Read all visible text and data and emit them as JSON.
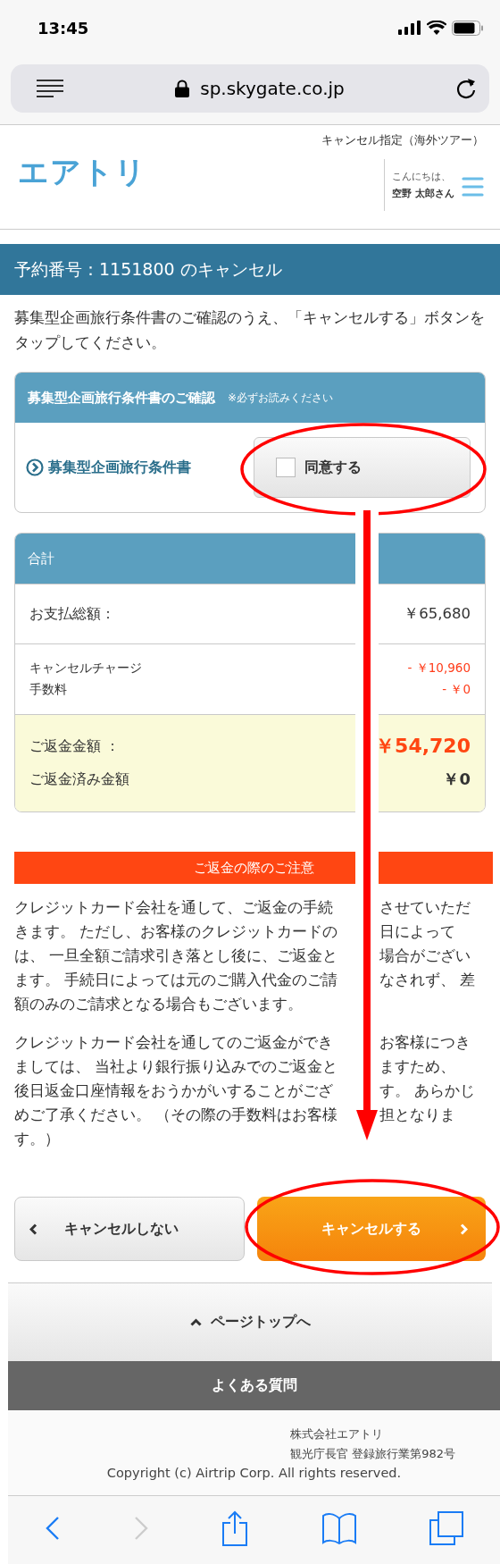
{
  "status_bar": {
    "time": "13:45"
  },
  "browser": {
    "url": "sp.skygate.co.jp"
  },
  "header": {
    "page_label": "キャンセル指定（海外ツアー）",
    "logo": "エアトリ",
    "greeting": "こんにちは、",
    "user_name": "空野 太郎さん"
  },
  "title": "予約番号：1151800 のキャンセル",
  "intro": "募集型企画旅行条件書のご確認のうえ、「キャンセルする」ボタンをタップしてください。",
  "terms": {
    "heading": "募集型企画旅行条件書のご確認",
    "note": "※必ずお読みください",
    "link": "募集型企画旅行条件書",
    "agree": {
      "label": "同意する",
      "checked": false
    }
  },
  "totals": {
    "heading": "合計",
    "sections": [
      {
        "highlighted": false,
        "items": [
          {
            "label": "お支払総額：",
            "value": "￥65,680",
            "kind": "amount"
          }
        ]
      },
      {
        "highlighted": false,
        "items": [
          {
            "label": "キャンセルチャージ",
            "value": "- ￥10,960",
            "kind": "charge"
          },
          {
            "label": "手数料",
            "value": "- ￥0",
            "kind": "charge"
          }
        ]
      },
      {
        "highlighted": true,
        "items": [
          {
            "label": "ご返金金額 ：",
            "value": "￥54,720",
            "kind": "refund"
          },
          {
            "label": "ご返金済み金額",
            "value": "￥0",
            "kind": "refunded"
          }
        ]
      }
    ]
  },
  "notice": {
    "heading": "ご返金の際のご注意",
    "paragraphs": [
      {
        "lines": [
          {
            "left": "クレジットカード会社を通して、ご返金の手続",
            "right": "させていただ"
          },
          {
            "left": "きます。 ただし、お客様のクレジットカードの",
            "right": "日によって"
          },
          {
            "left": "は、 一旦全額ご請求引き落とし後に、ご返金と",
            "right": "場合がござい"
          },
          {
            "left": "ます。 手続日によっては元のご購入代金のご請",
            "right": "なされず、 差"
          },
          {
            "left": "額のみのご請求となる場合もございます。"
          }
        ]
      },
      {
        "lines": [
          {
            "left": "クレジットカード会社を通してのご返金ができ",
            "right": "お客様につき"
          },
          {
            "left": "ましては、 当社より銀行振り込みでのご返金と",
            "right": "ますため、"
          },
          {
            "left": "後日返金口座情報をおうかがいすることがござ",
            "right": "す。 あらかじ"
          },
          {
            "left": "めご了承ください。 （その際の手数料はお客様",
            "right": "担となりま"
          },
          {
            "left": "す。）"
          }
        ]
      }
    ]
  },
  "buttons": [
    {
      "label": "キャンセルしない",
      "kind": "back"
    },
    {
      "label": "キャンセルする",
      "kind": "primary"
    }
  ],
  "page_top": "ページトップへ",
  "faq": "よくある質問",
  "footer": {
    "company": "株式会社エアトリ",
    "registration": "観光庁長官 登録旅行業第982号",
    "copyright": "Copyright (c) Airtrip Corp. All rights reserved."
  },
  "toolbar": {
    "back": {
      "disabled": false
    },
    "forward": {
      "disabled": true
    }
  }
}
